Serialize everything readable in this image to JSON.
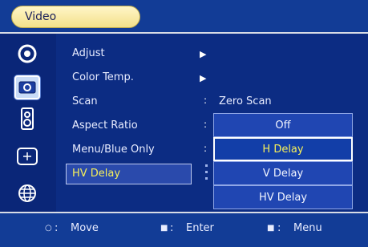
{
  "window": {
    "title": "Video"
  },
  "sidebar": {
    "icons": [
      {
        "name": "picture-adjust-icon",
        "active": false
      },
      {
        "name": "video-icon",
        "active": true
      },
      {
        "name": "audio-icon",
        "active": false
      },
      {
        "name": "setup-icon",
        "active": false
      },
      {
        "name": "language-icon",
        "active": false
      }
    ]
  },
  "menu": {
    "items": [
      {
        "label": "Adjust",
        "has_submenu": true,
        "value": ""
      },
      {
        "label": "Color Temp.",
        "has_submenu": true,
        "value": ""
      },
      {
        "label": "Scan",
        "has_submenu": false,
        "value": "Zero Scan"
      },
      {
        "label": "Aspect Ratio",
        "has_submenu": false,
        "value": ""
      },
      {
        "label": "Menu/Blue Only",
        "has_submenu": false,
        "value": ""
      },
      {
        "label": "HV Delay",
        "has_submenu": false,
        "value": "",
        "highlighted": true
      }
    ],
    "arrow_glyph": "▶",
    "colon_glyph": ":"
  },
  "submenu": {
    "options": [
      "Off",
      "H Delay",
      "V Delay",
      "HV Delay"
    ],
    "selected": "H Delay"
  },
  "footer": {
    "hints": [
      {
        "glyph": "○",
        "sep": ":",
        "label": "Move"
      },
      {
        "glyph": "■",
        "sep": ":",
        "label": "Enter"
      },
      {
        "glyph": "■",
        "sep": ":",
        "label": "Menu"
      }
    ]
  },
  "colors": {
    "background": "#0c2c83",
    "bar": "#123c96",
    "title_pill": "#f3e08a",
    "highlight_text": "#f7f05a"
  }
}
